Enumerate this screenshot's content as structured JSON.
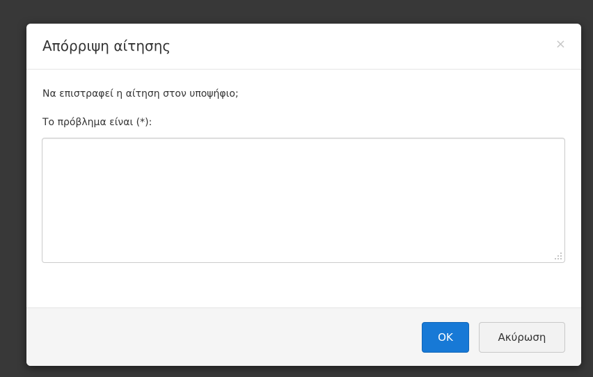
{
  "dialog": {
    "title": "Απόρριψη αίτησης",
    "close_symbol": "×",
    "question": "Να επιστραφεί η αίτηση στον υποψήφιο;",
    "field_label": "Το πρόβλημα είναι (*):",
    "textarea_value": "",
    "ok_label": "OK",
    "cancel_label": "Ακύρωση"
  },
  "colors": {
    "primary": "#1779d6",
    "backdrop": "#000000",
    "footer_bg": "#f5f5f5"
  },
  "icons": {
    "close": "close-icon",
    "resize": "resize-grip-icon"
  }
}
